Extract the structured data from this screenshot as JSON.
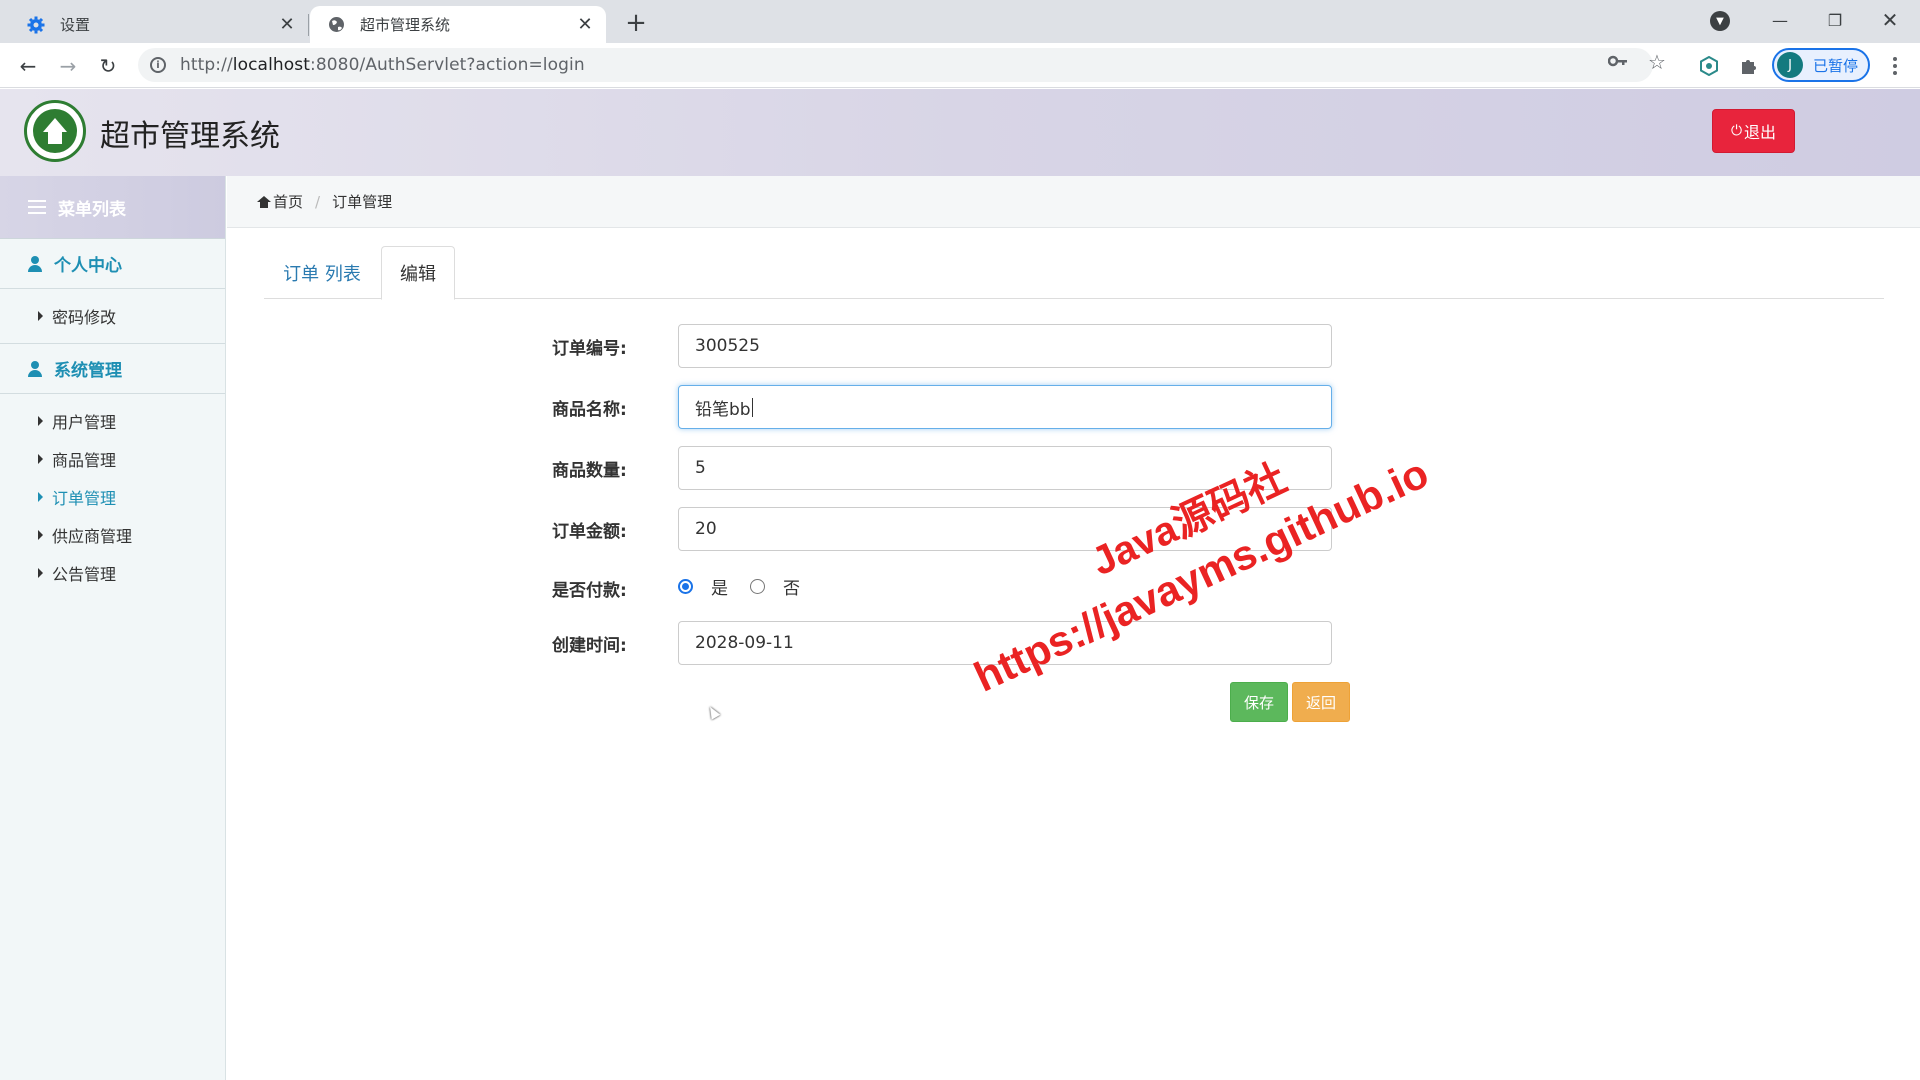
{
  "browser": {
    "tabs": [
      {
        "title": "设置",
        "icon": "gear-icon"
      },
      {
        "title": "超市管理系统",
        "icon": "globe-icon"
      }
    ],
    "url_prefix": "http://",
    "url_host": "localhost",
    "url_rest": ":8080/AuthServlet?action=login",
    "profile": {
      "initial": "J",
      "label": "已暂停"
    }
  },
  "header": {
    "title": "超市管理系统",
    "logout_label": "退出"
  },
  "sidebar": {
    "menu_title": "菜单列表",
    "groups": [
      {
        "title": "个人中心",
        "items": [
          "密码修改"
        ]
      },
      {
        "title": "系统管理",
        "items": [
          "用户管理",
          "商品管理",
          "订单管理",
          "供应商管理",
          "公告管理"
        ]
      }
    ],
    "active_item": "订单管理"
  },
  "breadcrumb": {
    "home": "首页",
    "current": "订单管理"
  },
  "tabs": {
    "list_label": "订单 列表",
    "edit_label": "编辑",
    "active": "编辑"
  },
  "form": {
    "order_no": {
      "label": "订单编号:",
      "value": "300525"
    },
    "product_name": {
      "label": "商品名称:",
      "value": "铅笔bb"
    },
    "quantity": {
      "label": "商品数量:",
      "value": "5"
    },
    "amount": {
      "label": "订单金额:",
      "value": "20"
    },
    "paid": {
      "label": "是否付款:",
      "options": [
        "是",
        "否"
      ],
      "selected": "是"
    },
    "created": {
      "label": "创建时间:",
      "value": "2028-09-11"
    },
    "save_label": "保存",
    "back_label": "返回"
  },
  "watermark": {
    "line1": "Java源码社",
    "line2": "https://javayms.github.io"
  },
  "colors": {
    "accent": "#1e8fb3",
    "logout": "#e8243c",
    "save": "#5cb85c",
    "back": "#f0ad4e",
    "watermark": "#ea2323"
  }
}
